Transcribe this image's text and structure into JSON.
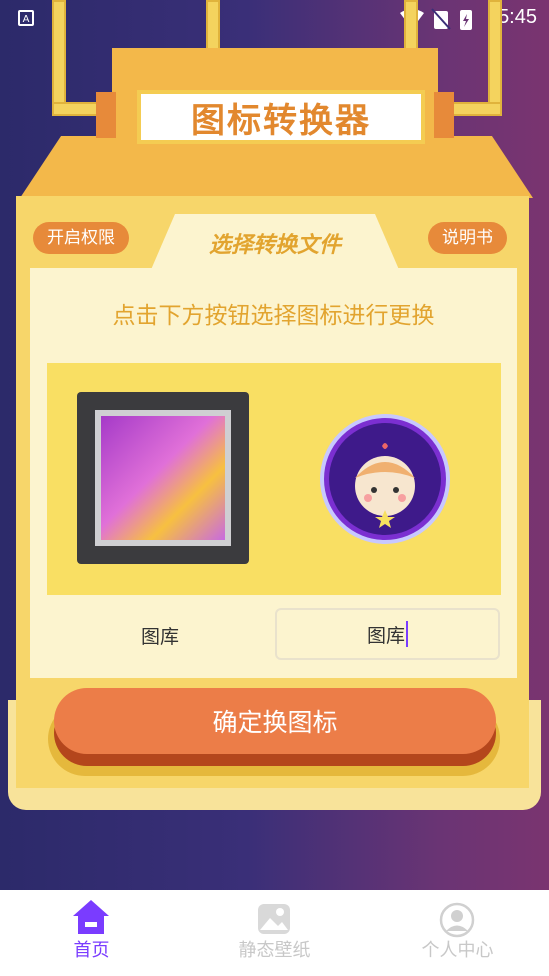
{
  "status_bar": {
    "app_indicator": "A",
    "time": "5:45"
  },
  "header": {
    "title": "图标转换器"
  },
  "panel": {
    "left_pill": "开启权限",
    "right_pill": "说明书",
    "tab_label": "选择转换文件",
    "hint": "点击下方按钮选择图标进行更换",
    "left_label": "图库",
    "right_input_value": "图库"
  },
  "confirm_button": "确定换图标",
  "bottom_nav": {
    "items": [
      {
        "label": "首页",
        "icon": "home-icon",
        "active": true
      },
      {
        "label": "静态壁纸",
        "icon": "wallpaper-icon",
        "active": false
      },
      {
        "label": "个人中心",
        "icon": "user-icon",
        "active": false
      }
    ]
  },
  "colors": {
    "accent": "#7a3cff",
    "orange": "#ec7d48",
    "gold": "#e2a42f",
    "panel": "#f7d66a"
  }
}
